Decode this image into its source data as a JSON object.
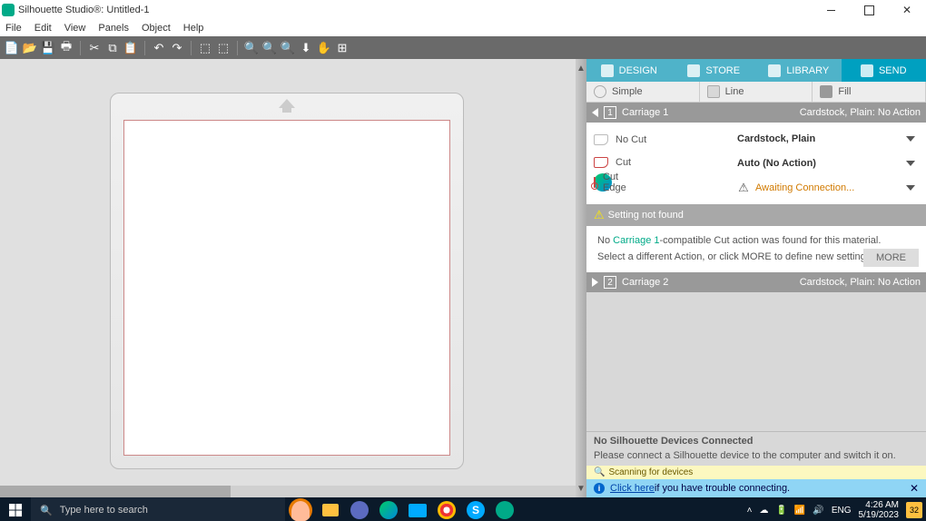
{
  "window": {
    "title": "Silhouette Studio®: Untitled-1"
  },
  "menu": {
    "file": "File",
    "edit": "Edit",
    "view": "View",
    "panels": "Panels",
    "object": "Object",
    "help": "Help"
  },
  "apptabs": {
    "design": "DESIGN",
    "store": "STORE",
    "library": "LIBRARY",
    "send": "SEND"
  },
  "modetabs": {
    "simple": "Simple",
    "line": "Line",
    "fill": "Fill"
  },
  "carriage1": {
    "title": "Carriage 1",
    "status": "Cardstock, Plain: No Action",
    "opts": {
      "nocut": "No Cut",
      "cut": "Cut",
      "edge": "Cut Edge"
    },
    "material": "Cardstock, Plain",
    "action": "Auto (No Action)",
    "connection": "Awaiting Connection...",
    "warn_title": "Setting not found",
    "msg_prefix": "No ",
    "msg_link": "Carriage 1",
    "msg_suffix": "-compatible Cut action was found for this material.",
    "msg2": "Select a different Action, or click MORE to define new settings.",
    "more": "MORE"
  },
  "carriage2": {
    "title": "Carriage 2",
    "status": "Cardstock, Plain: No Action"
  },
  "status": {
    "none": "No Silhouette Devices Connected",
    "please": "Please connect a Silhouette device to the computer and switch it on.",
    "scanning": "Scanning for devices",
    "clickhere": "Click here",
    "trouble": " if you have trouble connecting."
  },
  "taskbar": {
    "search": "Type here to search",
    "lang": "ENG",
    "time": "4:26 AM",
    "date": "5/19/2023",
    "notif": "32"
  }
}
